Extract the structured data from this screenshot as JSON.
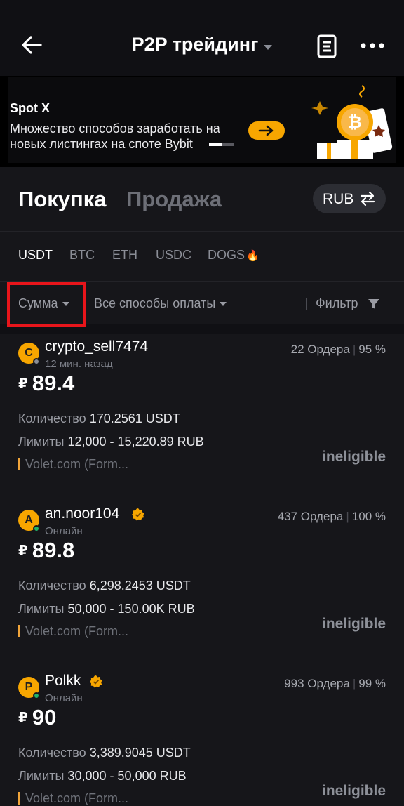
{
  "header": {
    "title": "P2P трейдинг"
  },
  "banner": {
    "title": "Spot X",
    "text": "Множество способов заработать на новых листингах на споте Bybit",
    "accent": "#f7a600"
  },
  "trade_tabs": {
    "buy": "Покупка",
    "sell": "Продажа"
  },
  "currency": {
    "label": "RUB"
  },
  "coins": [
    "USDT",
    "BTC",
    "ETH",
    "USDC",
    "DOGS"
  ],
  "coin_extra": {
    "dogs_icon": "🔥"
  },
  "filters": {
    "amount": "Сумма",
    "payment": "Все способы оплаты",
    "filter": "Фильтр"
  },
  "listings": [
    {
      "avatar": "C",
      "name": "crypto_sell7474",
      "status": "12 мин. назад",
      "status_color": "#8a8d96",
      "verified": false,
      "orders": "22 Ордера",
      "rate": "95 %",
      "currency_symbol": "₽",
      "price": "89.4",
      "qty_label": "Количество",
      "qty": "170.2561 USDT",
      "limit_label": "Лимиты",
      "limits": "12,000 - 15,220.89 RUB",
      "payment": "Volet.com (Form...",
      "action": "ineligible"
    },
    {
      "avatar": "A",
      "name": "an.noor104",
      "status": "Онлайн",
      "status_color": "#20b26c",
      "verified": true,
      "orders": "437 Ордера",
      "rate": "100 %",
      "currency_symbol": "₽",
      "price": "89.8",
      "qty_label": "Количество",
      "qty": "6,298.2453 USDT",
      "limit_label": "Лимиты",
      "limits": "50,000 - 150.00K RUB",
      "payment": "Volet.com (Form...",
      "action": "ineligible"
    },
    {
      "avatar": "P",
      "name": "Polkk",
      "status": "Онлайн",
      "status_color": "#20b26c",
      "verified": true,
      "orders": "993 Ордера",
      "rate": "99 %",
      "currency_symbol": "₽",
      "price": "90",
      "qty_label": "Количество",
      "qty": "3,389.9045 USDT",
      "limit_label": "Лимиты",
      "limits": "30,000 - 50,000 RUB",
      "payment": "Volet.com (Form...",
      "action": "ineligible"
    }
  ]
}
